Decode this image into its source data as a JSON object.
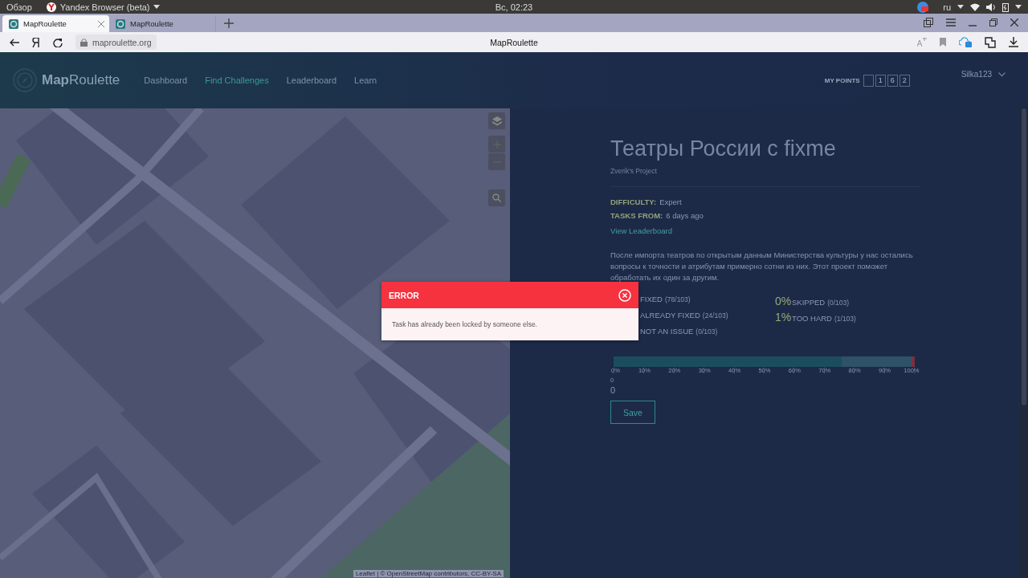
{
  "os_bar": {
    "activities": "Обзор",
    "app": "Yandex Browser (beta)",
    "clock": "Вс, 02:23",
    "language": "ru"
  },
  "browser": {
    "tabs": [
      {
        "title": "MapRoulette",
        "selected": true
      },
      {
        "title": "MapRoulette",
        "selected": false
      }
    ],
    "address": "maproulette.org",
    "page_title": "MapRoulette"
  },
  "header": {
    "logo_bold": "Map",
    "logo_rest": "Roulette",
    "nav": [
      {
        "label": "Dashboard",
        "selected": false
      },
      {
        "label": "Find Challenges",
        "selected": true
      },
      {
        "label": "Leaderboard",
        "selected": false
      },
      {
        "label": "Learn",
        "selected": false
      }
    ],
    "points_label": "MY POINTS",
    "points_digits": [
      "1",
      "6",
      "2"
    ],
    "user": "Silka123"
  },
  "map": {
    "kind": "picture",
    "attribution": "Leaflet | © OpenStreetMap contributors, CC-BY-SA"
  },
  "challenge": {
    "title": "Театры России с fixme",
    "project": "Zverik's Project",
    "meta": [
      {
        "label": "DIFFICULTY:",
        "value": "Expert"
      },
      {
        "label": "TASKS FROM:",
        "value": "6 days ago"
      }
    ],
    "leaderboard_link": "View Leaderboard",
    "description": "После импорта театров по открытым данным Министерства культуры у нас остались вопросы к точности и атрибутам примерно сотни из них. Этот проект поможет обработать их один за другим.",
    "stats": [
      {
        "label": "FIXED",
        "count": "(78/103)"
      },
      {
        "pct": "0%",
        "label": "SKIPPED",
        "count": "(0/103)"
      },
      {
        "label": "ALREADY FIXED",
        "count": "(24/103)"
      },
      {
        "pct": "1%",
        "label": "TOO HARD",
        "count": "(1/103)"
      },
      {
        "label": "NOT AN ISSUE",
        "count": "(0/103)"
      }
    ],
    "progress": {
      "segments": [
        {
          "kind": "fixed",
          "level": 0.757
        },
        {
          "kind": "already_fixed",
          "level": 0.233
        },
        {
          "kind": "too_hard",
          "level": 0.01
        }
      ],
      "ticks": [
        "0%",
        "10%",
        "20%",
        "30%",
        "40%",
        "50%",
        "60%",
        "70%",
        "80%",
        "90%",
        "100%"
      ]
    },
    "small_zero": "0",
    "big_zero": "0",
    "save": "Save"
  },
  "modal": {
    "title": "ERROR",
    "message": "Task has already been locked by someone else."
  }
}
